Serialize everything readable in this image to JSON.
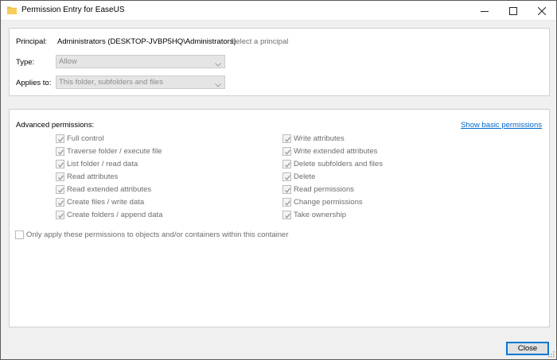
{
  "window": {
    "title": "Permission Entry for EaseUS",
    "icon": "folder-icon"
  },
  "principal": {
    "label": "Principal:",
    "value": "Administrators (DESKTOP-JVBP5HQ\\Administrators)",
    "select_link": "Select a principal"
  },
  "type": {
    "label": "Type:",
    "value": "Allow"
  },
  "applies_to": {
    "label": "Applies to:",
    "value": "This folder, subfolders and files"
  },
  "advanced": {
    "title": "Advanced permissions:",
    "basic_link": "Show basic permissions",
    "left": [
      {
        "label": "Full control",
        "checked": true
      },
      {
        "label": "Traverse folder / execute file",
        "checked": true
      },
      {
        "label": "List folder / read data",
        "checked": true
      },
      {
        "label": "Read attributes",
        "checked": true
      },
      {
        "label": "Read extended attributes",
        "checked": true
      },
      {
        "label": "Create files / write data",
        "checked": true
      },
      {
        "label": "Create folders / append data",
        "checked": true
      }
    ],
    "right": [
      {
        "label": "Write attributes",
        "checked": true
      },
      {
        "label": "Write extended attributes",
        "checked": true
      },
      {
        "label": "Delete subfolders and files",
        "checked": true
      },
      {
        "label": "Delete",
        "checked": true
      },
      {
        "label": "Read permissions",
        "checked": true
      },
      {
        "label": "Change permissions",
        "checked": true
      },
      {
        "label": "Take ownership",
        "checked": true
      }
    ],
    "only_apply": {
      "label": "Only apply these permissions to objects and/or containers within this container",
      "checked": false
    }
  },
  "footer": {
    "close_label": "Close"
  },
  "colors": {
    "link_blue": "#0066cc",
    "accent": "#0078d7",
    "disabled_text": "#6d6d6d"
  }
}
